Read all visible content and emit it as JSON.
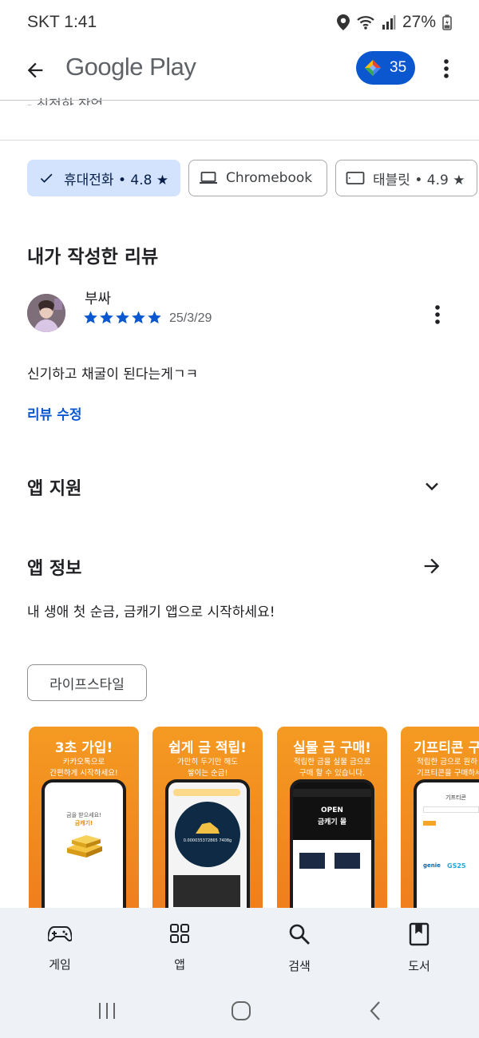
{
  "status": {
    "carrier_time": "SKT 1:41",
    "battery": "27%"
  },
  "header": {
    "title": "Google Play",
    "points": "35"
  },
  "partial_text": "- 최적화 작업",
  "device_chips": [
    {
      "label": "휴대전화 • 4.8 ★",
      "selected": true
    },
    {
      "label": "Chromebook",
      "selected": false
    },
    {
      "label": "태블릿 • 4.9 ★",
      "selected": false
    }
  ],
  "my_review": {
    "section_title": "내가 작성한 리뷰",
    "reviewer": "부싸",
    "rating": 5,
    "date": "25/3/29",
    "text": "신기하고 채굴이 된다는게ㄱㅋ",
    "edit_label": "리뷰 수정"
  },
  "app_support": {
    "title": "앱 지원"
  },
  "app_info": {
    "title": "앱 정보",
    "description": "내 생애 첫 순금, 금캐기 앱으로 시작하세요!"
  },
  "category_tag": "라이프스타일",
  "screenshots": [
    {
      "title": "3초 가입!",
      "sub1": "카카오톡으로",
      "sub2": "간편하게 시작하세요!",
      "screen1": "금을 받으세요!",
      "screen2": "금캐기!"
    },
    {
      "title": "쉽게 금 적립!",
      "sub1": "가만히 두기만 해도",
      "sub2": "쌓이는 순금!",
      "screen1": "0.000035372865 7408g"
    },
    {
      "title": "실물 금 구매!",
      "sub1": "적립한 금을 실물 금으로",
      "sub2": "구매 할 수 있습니다.",
      "screen1": "OPEN",
      "screen2": "금캐기 몰"
    },
    {
      "title": "기프티콘 구",
      "sub1": "적립한 금으로 원하",
      "sub2": "기프티콘을 구매하세",
      "screen1": "기프티콘",
      "brands": [
        "genie",
        "GS25"
      ]
    }
  ],
  "bottom_nav": [
    {
      "label": "게임",
      "icon": "gamepad-icon"
    },
    {
      "label": "앱",
      "icon": "apps-grid-icon"
    },
    {
      "label": "검색",
      "icon": "search-icon"
    },
    {
      "label": "도서",
      "icon": "book-icon"
    }
  ],
  "colors": {
    "accent": "#0b57d0",
    "chip_selected": "#d3e3fd",
    "star": "#0b57d0",
    "screenshot_orange": "#f28e1f"
  }
}
